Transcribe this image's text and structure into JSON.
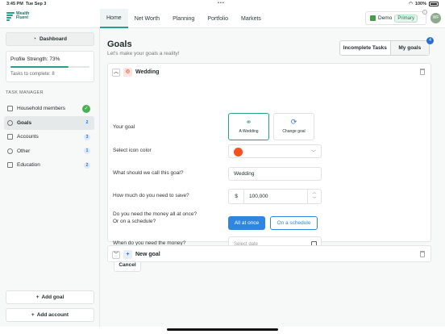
{
  "status_bar": {
    "time": "3:45 PM",
    "date": "Tue Sep 3",
    "battery": "100%"
  },
  "app": {
    "logo_line1": "Wealth",
    "logo_line2": "Fluent"
  },
  "nav": {
    "tabs": [
      "Home",
      "Net Worth",
      "Planning",
      "Portfolio",
      "Markets"
    ],
    "active": "Home"
  },
  "account": {
    "name": "Demo",
    "badge": "Primary",
    "avatar_initials": "WF"
  },
  "sidebar": {
    "dashboard_label": "Dashboard",
    "profile_strength": "Profile Strength: 73%",
    "profile_strength_value": 73,
    "tasks_to_complete": "Tasks to complete: 8",
    "task_manager_title": "TASK MANAGER",
    "items": [
      {
        "label": "Household members",
        "count": "",
        "complete": true
      },
      {
        "label": "Goals",
        "count": "2",
        "complete": false
      },
      {
        "label": "Accounts",
        "count": "3",
        "complete": false
      },
      {
        "label": "Other",
        "count": "1",
        "complete": false
      },
      {
        "label": "Education",
        "count": "2",
        "complete": false
      }
    ],
    "add_goal": "Add goal",
    "add_account": "Add account"
  },
  "main": {
    "title": "Goals",
    "subtitle": "Let's make your goals a reality!",
    "toggle": {
      "incomplete": "Incomplete Tasks",
      "my_goals": "My goals",
      "badge": "4"
    },
    "goal": {
      "name": "Wedding",
      "your_goal_label": "Your goal",
      "choice_selected": "A Wedding",
      "choice_change": "Change goal",
      "icon_color_label": "Select icon color",
      "icon_color": "#f4511e",
      "call_label": "What should we call this goal?",
      "call_value": "Wedding",
      "amount_label": "How much do you need to save?",
      "currency": "$",
      "amount_value": "100,000",
      "schedule_label_1": "Do you need the money all at once?",
      "schedule_label_2": "Or on a schedule?",
      "all_at_once": "All at once",
      "on_schedule": "On a schedule",
      "when_label": "When do you need the money?",
      "date_placeholder": "Select date",
      "cancel": "Cancel"
    },
    "new_goal": "New goal"
  }
}
